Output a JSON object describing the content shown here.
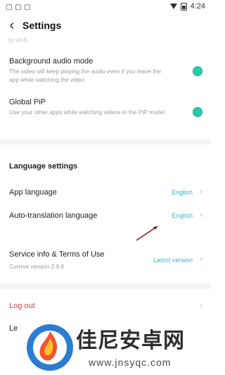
{
  "status": {
    "time": "4:24",
    "icons": [
      "status-glyph-1",
      "status-glyph-2",
      "status-glyph-3"
    ]
  },
  "header": {
    "title": "Settings",
    "back_icon": "back-arrow-icon"
  },
  "top_hint": "to wi-fi.",
  "settings": {
    "background_audio": {
      "label": "Background audio mode",
      "desc": "The video will keep playing the audio even if you leave the app while watching the video"
    },
    "global_pip": {
      "label": "Global PiP",
      "desc": "Use your other apps while watching videos in the PiP mode!"
    }
  },
  "language": {
    "title": "Language settings",
    "items": [
      {
        "label": "App language",
        "value": "English"
      },
      {
        "label": "Auto-translation language",
        "value": "English"
      }
    ]
  },
  "service": {
    "label": "Service info & Terms of Use",
    "version": "Current version 2.9.6",
    "value": "Latest version"
  },
  "footer": {
    "logout": "Log out",
    "le": "Le"
  },
  "watermark": {
    "brand": "佳尼安卓网",
    "url": "www.jnsyqc.com"
  },
  "colors": {
    "accent": "#2dc9a7",
    "link": "#39b6c6"
  }
}
